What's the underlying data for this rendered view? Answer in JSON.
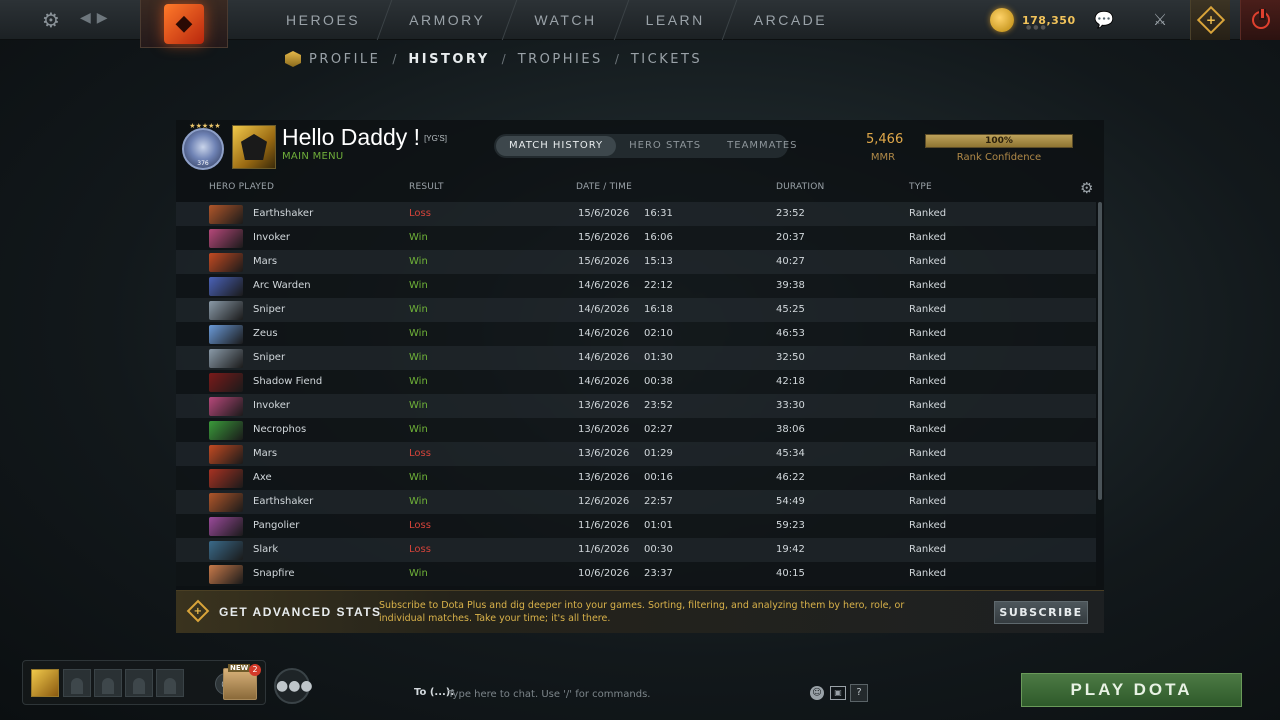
{
  "topbar": {
    "nav": [
      "HEROES",
      "ARMORY",
      "WATCH",
      "LEARN",
      "ARCADE"
    ],
    "currency": "178,350",
    "icons": {
      "settings": "gear-icon",
      "back": "arrow-left-icon",
      "forward": "arrow-right-icon",
      "logo": "dota-logo-icon",
      "currency": "shards-coin-icon",
      "chat": "chat-icon",
      "armory": "armory-icon",
      "plus": "dota-plus-icon",
      "power": "power-icon"
    }
  },
  "subnav": {
    "items": [
      "PROFILE",
      "HISTORY",
      "TROPHIES",
      "TICKETS"
    ],
    "active": "HISTORY"
  },
  "profile": {
    "name": "Hello Daddy !",
    "tag": "[YG'S]",
    "status": "MAIN MENU",
    "rank_stars": "★★★★★",
    "rank_number": "376",
    "mmr_value": "5,466",
    "mmr_label": "MMR",
    "confidence_value": "100%",
    "confidence_fraction": 1.0,
    "confidence_label": "Rank Confidence"
  },
  "tabs": [
    "MATCH HISTORY",
    "HERO STATS",
    "TEAMMATES"
  ],
  "table": {
    "headers": {
      "hero": "HERO PLAYED",
      "result": "RESULT",
      "datetime": "DATE / TIME",
      "duration": "DURATION",
      "type": "TYPE"
    },
    "rows": [
      {
        "hero": "Earthshaker",
        "result": "Loss",
        "date": "15/6/2026",
        "time": "16:31",
        "duration": "23:52",
        "type": "Ranked",
        "color": "#b0562a"
      },
      {
        "hero": "Invoker",
        "result": "Win",
        "date": "15/6/2026",
        "time": "16:06",
        "duration": "20:37",
        "type": "Ranked",
        "color": "#b6487a"
      },
      {
        "hero": "Mars",
        "result": "Win",
        "date": "15/6/2026",
        "time": "15:13",
        "duration": "40:27",
        "type": "Ranked",
        "color": "#c24a22"
      },
      {
        "hero": "Arc Warden",
        "result": "Win",
        "date": "14/6/2026",
        "time": "22:12",
        "duration": "39:38",
        "type": "Ranked",
        "color": "#4a62b8"
      },
      {
        "hero": "Sniper",
        "result": "Win",
        "date": "14/6/2026",
        "time": "16:18",
        "duration": "45:25",
        "type": "Ranked",
        "color": "#8a9aa8"
      },
      {
        "hero": "Zeus",
        "result": "Win",
        "date": "14/6/2026",
        "time": "02:10",
        "duration": "46:53",
        "type": "Ranked",
        "color": "#6a9ad8"
      },
      {
        "hero": "Sniper",
        "result": "Win",
        "date": "14/6/2026",
        "time": "01:30",
        "duration": "32:50",
        "type": "Ranked",
        "color": "#8a9aa8"
      },
      {
        "hero": "Shadow Fiend",
        "result": "Win",
        "date": "14/6/2026",
        "time": "00:38",
        "duration": "42:18",
        "type": "Ranked",
        "color": "#7a1a1a"
      },
      {
        "hero": "Invoker",
        "result": "Win",
        "date": "13/6/2026",
        "time": "23:52",
        "duration": "33:30",
        "type": "Ranked",
        "color": "#b6487a"
      },
      {
        "hero": "Necrophos",
        "result": "Win",
        "date": "13/6/2026",
        "time": "02:27",
        "duration": "38:06",
        "type": "Ranked",
        "color": "#3a9a3a"
      },
      {
        "hero": "Mars",
        "result": "Loss",
        "date": "13/6/2026",
        "time": "01:29",
        "duration": "45:34",
        "type": "Ranked",
        "color": "#c24a22"
      },
      {
        "hero": "Axe",
        "result": "Win",
        "date": "13/6/2026",
        "time": "00:16",
        "duration": "46:22",
        "type": "Ranked",
        "color": "#a83222"
      },
      {
        "hero": "Earthshaker",
        "result": "Win",
        "date": "12/6/2026",
        "time": "22:57",
        "duration": "54:49",
        "type": "Ranked",
        "color": "#b0562a"
      },
      {
        "hero": "Pangolier",
        "result": "Loss",
        "date": "11/6/2026",
        "time": "01:01",
        "duration": "59:23",
        "type": "Ranked",
        "color": "#9a4a9a"
      },
      {
        "hero": "Slark",
        "result": "Loss",
        "date": "11/6/2026",
        "time": "00:30",
        "duration": "19:42",
        "type": "Ranked",
        "color": "#3a6a8a"
      },
      {
        "hero": "Snapfire",
        "result": "Win",
        "date": "10/6/2026",
        "time": "23:37",
        "duration": "40:15",
        "type": "Ranked",
        "color": "#c87a4a"
      }
    ]
  },
  "banner": {
    "title": "GET ADVANCED STATS",
    "description": "Subscribe to Dota Plus and dig deeper into your games. Sorting, filtering, and analyzing them by hero, role, or individual matches. Take your time; it's all there.",
    "button": "SUBSCRIBE"
  },
  "bottom": {
    "new_badge": "NEW",
    "new_count": "2",
    "chat_to": "To (...):",
    "chat_placeholder": "Type here to chat. Use '/' for commands.",
    "help": "?",
    "play_button": "PLAY DOTA"
  }
}
